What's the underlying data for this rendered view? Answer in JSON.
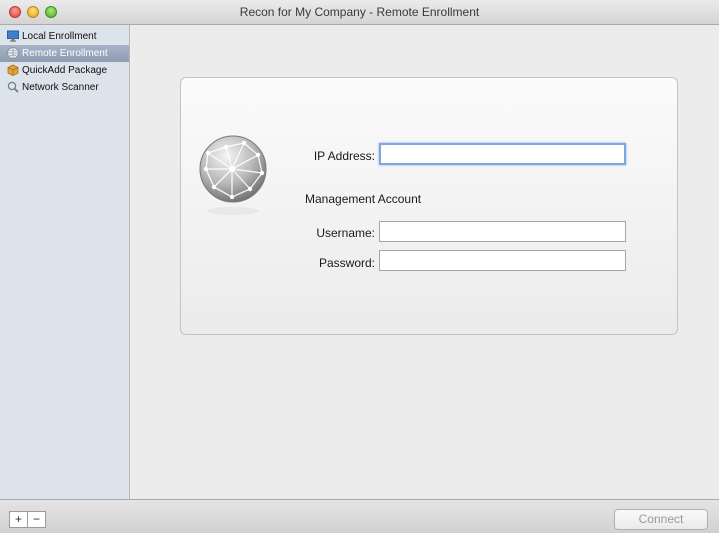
{
  "window": {
    "title": "Recon for My Company - Remote Enrollment"
  },
  "sidebar": {
    "items": [
      {
        "label": "Local Enrollment",
        "icon": "monitor-icon"
      },
      {
        "label": "Remote Enrollment",
        "icon": "globe-icon",
        "selected": true
      },
      {
        "label": "QuickAdd Package",
        "icon": "package-icon"
      },
      {
        "label": "Network Scanner",
        "icon": "magnifier-icon"
      }
    ]
  },
  "form": {
    "ip_label": "IP Address:",
    "ip_value": "",
    "section_title": "Management Account",
    "username_label": "Username:",
    "username_value": "",
    "password_label": "Password:",
    "password_value": ""
  },
  "bottom_bar": {
    "add_label": "+",
    "remove_label": "−",
    "connect_label": "Connect"
  },
  "colors": {
    "selection": "#8e9cb2",
    "focus_ring": "#7ea6e0",
    "sidebar_bg": "#dde3ea"
  }
}
